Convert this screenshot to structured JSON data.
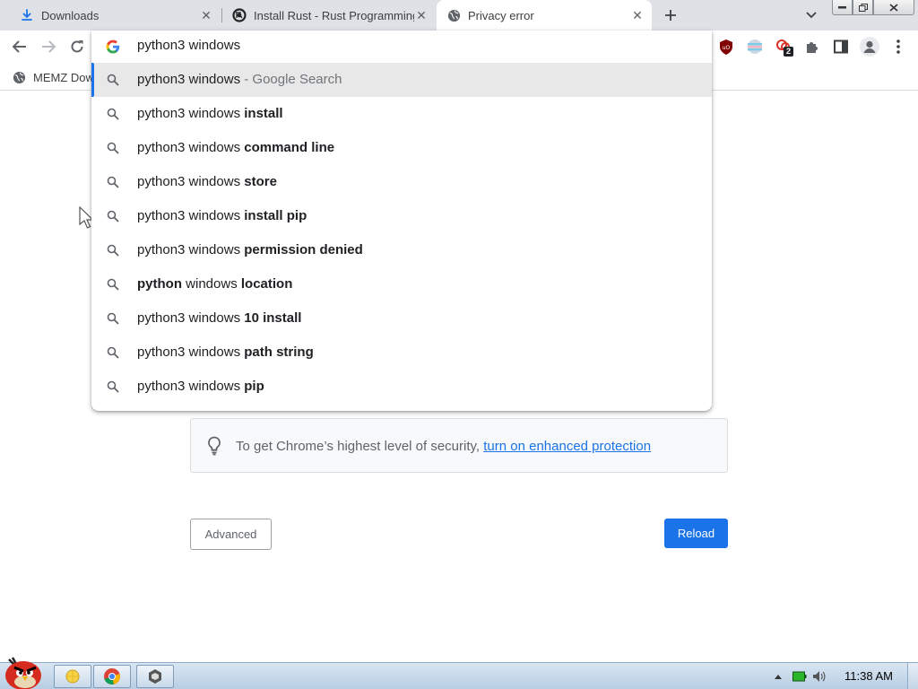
{
  "tabs": [
    {
      "title": "Downloads",
      "icon": "download-icon"
    },
    {
      "title": "Install Rust - Rust Programming Language",
      "icon": "rust-logo-icon"
    },
    {
      "title": "Privacy error",
      "icon": "globe-icon",
      "active": true
    }
  ],
  "toolbar": {
    "extension_badge": "2"
  },
  "bookmarks": [
    {
      "label": "MEMZ Dow",
      "icon": "globe-icon"
    }
  ],
  "omnibox": {
    "input": "python3 windows",
    "suggestions": [
      {
        "plain": "python3 windows",
        "bold": "",
        "suffix": " - Google Search"
      },
      {
        "plain": "python3 windows ",
        "bold": "install",
        "suffix": ""
      },
      {
        "plain": "python3 windows ",
        "bold": "command line",
        "suffix": ""
      },
      {
        "plain": "python3 windows ",
        "bold": "store",
        "suffix": ""
      },
      {
        "plain": "python3 windows ",
        "bold": "install pip",
        "suffix": ""
      },
      {
        "plain": "python3 windows ",
        "bold": "permission denied",
        "suffix": ""
      },
      {
        "pre_bold": "python",
        "plain": " windows ",
        "bold": "location",
        "suffix": ""
      },
      {
        "plain": "python3 windows ",
        "bold": "10 install",
        "suffix": ""
      },
      {
        "plain": "python3 windows ",
        "bold": "path string",
        "suffix": ""
      },
      {
        "plain": "python3 windows ",
        "bold": "pip",
        "suffix": ""
      }
    ]
  },
  "page": {
    "enhanced_text": "To get Chrome’s highest level of security, ",
    "enhanced_link": "turn on enhanced protection",
    "advanced_button": "Advanced",
    "reload_button": "Reload"
  },
  "taskbar": {
    "clock": "11:38 AM"
  },
  "colors": {
    "accent": "#1a73e8",
    "tabstrip": "#dee1e6",
    "selected_row": "#e8e8e8"
  }
}
